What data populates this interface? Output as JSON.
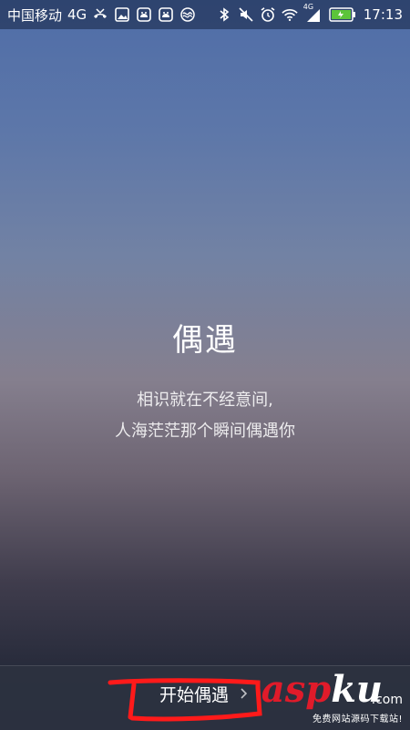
{
  "status_bar": {
    "carrier": "中国移动",
    "network": "4G",
    "signal_badge": "4G",
    "time": "17:13",
    "icons": [
      "missed-call-icon",
      "image-icon",
      "android-icon",
      "android-icon",
      "wave-icon",
      "bluetooth-icon",
      "mute-icon",
      "alarm-icon",
      "wifi-icon",
      "signal-icon",
      "battery-icon"
    ]
  },
  "intro": {
    "title": "偶遇",
    "line1": "相识就在不经意间,",
    "line2": "人海茫茫那个瞬间偶遇你"
  },
  "bottom": {
    "start_label": "开始偶遇",
    "annotation_color": "#ff1a1a"
  },
  "watermark": {
    "logo_a": "a",
    "logo_s": "s",
    "logo_p": "p",
    "logo_k": "k",
    "logo_u": "u",
    "logo_com": ".com",
    "tagline": "免费网站源码下载站!"
  },
  "colors": {
    "accent_red": "#e01b2a",
    "text": "#ffffff"
  }
}
